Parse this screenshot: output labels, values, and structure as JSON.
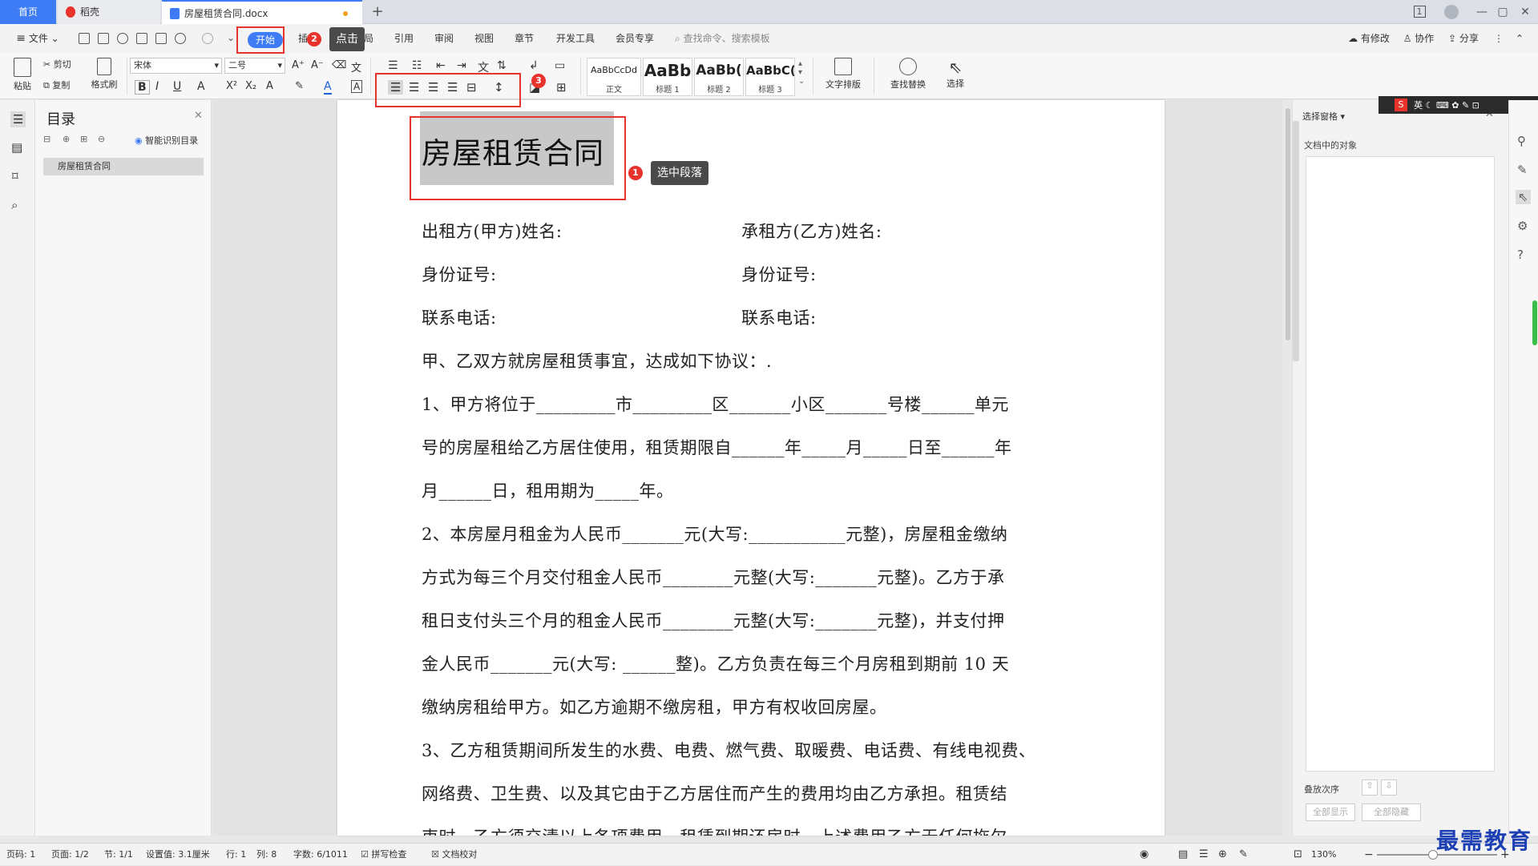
{
  "titlebar": {
    "tabs": [
      {
        "label": "首页"
      },
      {
        "label": "稻壳"
      },
      {
        "label": "房屋租赁合同.docx"
      }
    ],
    "new_tab": "+",
    "win_controls": [
      "1",
      "—",
      "▢",
      "✕"
    ]
  },
  "menubar": {
    "file_label": "文件",
    "items": [
      "开始",
      "插入",
      "页面布局",
      "引用",
      "审阅",
      "视图",
      "章节",
      "开发工具",
      "会员专享"
    ],
    "search_placeholder": "查找命令、搜索模板",
    "right_items": [
      "有修改",
      "协作",
      "分享"
    ]
  },
  "ribbon": {
    "paste": "粘贴",
    "cut": "剪切",
    "copy": "复制",
    "format_painter": "格式刷",
    "font_name": "宋体",
    "font_size": "二号",
    "styles": [
      {
        "preview": "AaBbCcDd",
        "label": "正文"
      },
      {
        "preview": "AaBb",
        "label": "标题 1"
      },
      {
        "preview": "AaBb(",
        "label": "标题 2"
      },
      {
        "preview": "AaBbC(",
        "label": "标题 3"
      }
    ],
    "text_layout": "文字排版",
    "find_replace": "查找替换",
    "select": "选择"
  },
  "nav": {
    "title": "目录",
    "smart_toc": "智能识别目录",
    "items": [
      "房屋租赁合同"
    ]
  },
  "document": {
    "title": "房屋租赁合同",
    "lines": [
      "出租方(甲方)姓名:",
      "承租方(乙方)姓名:",
      "身份证号:",
      "身份证号:",
      "联系电话:",
      "联系电话:",
      "甲、乙双方就房屋租赁事宜，达成如下协议：.",
      "1、甲方将位于_________市_________区_______小区_______号楼______单元",
      "号的房屋租给乙方居住使用，租赁期限自______年_____月_____日至______年",
      "月______日，租用期为_____年。",
      "2、本房屋月租金为人民币_______元(大写:___________元整)，房屋租金缴纳",
      "方式为每三个月交付租金人民币________元整(大写:_______元整)。乙方于承",
      "租日支付头三个月的租金人民币________元整(大写:_______元整)，并支付押",
      "金人民币_______元(大写: ______整)。乙方负责在每三个月房租到期前 10 天",
      "缴纳房租给甲方。如乙方逾期不缴房租，甲方有权收回房屋。",
      "3、乙方租赁期间所发生的水费、电费、燃气费、取暖费、电话费、有线电视费、",
      "网络费、卫生费、以及其它由于乙方居住而产生的费用均由乙方承担。租赁结",
      "束时，乙方须交清以上各项费用。租赁到期还房时，上述费用乙方无任何拖欠"
    ]
  },
  "annotations": {
    "badge1": "1",
    "tip1": "选中段落",
    "badge2": "2",
    "tip2": "点击",
    "badge3": "3"
  },
  "rightpanel": {
    "title": "选择窗格",
    "objects_label": "文档中的对象",
    "order_label": "叠放次序",
    "show_all": "全部显示",
    "hide_all": "全部隐藏"
  },
  "statusbar": {
    "page_no": "页码: 1",
    "page": "页面: 1/2",
    "section": "节: 1/1",
    "setting": "设置值: 3.1厘米",
    "row": "行: 1",
    "col": "列: 8",
    "words": "字数: 6/1011",
    "spell": "拼写检查",
    "proof": "文档校对",
    "zoom": "130%"
  },
  "watermark": "最需教育"
}
